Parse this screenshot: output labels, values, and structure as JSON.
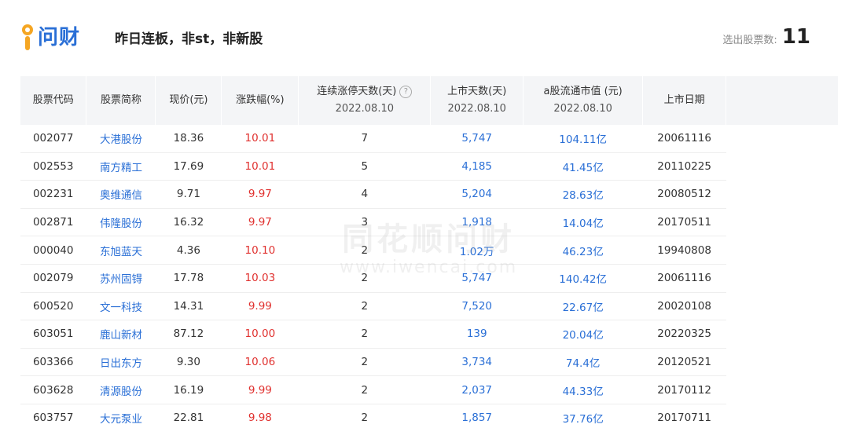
{
  "header": {
    "logo_text": "问财",
    "query": "昨日连板，非st，非新股",
    "result_label": "选出股票数:",
    "result_count": "11"
  },
  "columns": {
    "code": "股票代码",
    "name": "股票简称",
    "price": "现价(元)",
    "chg": "涨跌幅(%)",
    "streak": "连续涨停天数(天)",
    "streak_date": "2022.08.10",
    "days": "上市天数(天)",
    "days_date": "2022.08.10",
    "cap": "a股流通市值 (元)",
    "cap_date": "2022.08.10",
    "listdate": "上市日期"
  },
  "watermark": {
    "cn": "同花顺问财",
    "en": "www.iwencai.com"
  },
  "rows": [
    {
      "code": "002077",
      "name": "大港股份",
      "price": "18.36",
      "chg": "10.01",
      "streak": "7",
      "days": "5,747",
      "cap": "104.11亿",
      "listdate": "20061116"
    },
    {
      "code": "002553",
      "name": "南方精工",
      "price": "17.69",
      "chg": "10.01",
      "streak": "5",
      "days": "4,185",
      "cap": "41.45亿",
      "listdate": "20110225"
    },
    {
      "code": "002231",
      "name": "奥维通信",
      "price": "9.71",
      "chg": "9.97",
      "streak": "4",
      "days": "5,204",
      "cap": "28.63亿",
      "listdate": "20080512"
    },
    {
      "code": "002871",
      "name": "伟隆股份",
      "price": "16.32",
      "chg": "9.97",
      "streak": "3",
      "days": "1,918",
      "cap": "14.04亿",
      "listdate": "20170511"
    },
    {
      "code": "000040",
      "name": "东旭蓝天",
      "price": "4.36",
      "chg": "10.10",
      "streak": "2",
      "days": "1.02万",
      "cap": "46.23亿",
      "listdate": "19940808"
    },
    {
      "code": "002079",
      "name": "苏州固锝",
      "price": "17.78",
      "chg": "10.03",
      "streak": "2",
      "days": "5,747",
      "cap": "140.42亿",
      "listdate": "20061116"
    },
    {
      "code": "600520",
      "name": "文一科技",
      "price": "14.31",
      "chg": "9.99",
      "streak": "2",
      "days": "7,520",
      "cap": "22.67亿",
      "listdate": "20020108"
    },
    {
      "code": "603051",
      "name": "鹿山新材",
      "price": "87.12",
      "chg": "10.00",
      "streak": "2",
      "days": "139",
      "cap": "20.04亿",
      "listdate": "20220325"
    },
    {
      "code": "603366",
      "name": "日出东方",
      "price": "9.30",
      "chg": "10.06",
      "streak": "2",
      "days": "3,734",
      "cap": "74.4亿",
      "listdate": "20120521"
    },
    {
      "code": "603628",
      "name": "清源股份",
      "price": "16.19",
      "chg": "9.99",
      "streak": "2",
      "days": "2,037",
      "cap": "44.33亿",
      "listdate": "20170112"
    },
    {
      "code": "603757",
      "name": "大元泵业",
      "price": "22.81",
      "chg": "9.98",
      "streak": "2",
      "days": "1,857",
      "cap": "37.76亿",
      "listdate": "20170711"
    }
  ],
  "colors": {
    "link": "#2a6fd6",
    "up": "#e0312f",
    "header_bg": "#f4f5f7"
  },
  "icons": {
    "logo": "iwencai-logo-icon",
    "help": "question-circle-icon"
  }
}
